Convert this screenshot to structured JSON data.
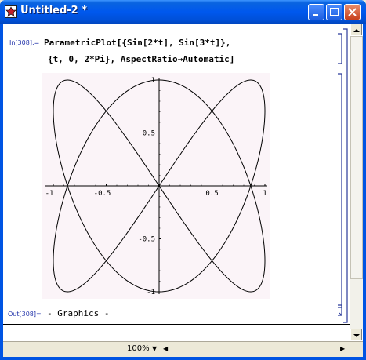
{
  "window": {
    "title": "Untitled-2 *",
    "icon": "mathematica-notebook-icon"
  },
  "cell_input": {
    "label": "In[308]:=",
    "line1": "ParametricPlot[{Sin[2*t], Sin[3*t]},",
    "line2": "{t, 0, 2*Pi}, AspectRatio→Automatic]"
  },
  "cell_output": {
    "label": "Out[308]=",
    "text": "- Graphics -"
  },
  "plot": {
    "x_ticks": [
      "-1",
      "-0.5",
      "0.5",
      "1"
    ],
    "y_ticks": [
      "1",
      "0.5",
      "-0.5",
      "-1"
    ],
    "background": "#fbf4f8"
  },
  "chart_data": {
    "type": "line",
    "title": "",
    "xlabel": "",
    "ylabel": "",
    "xlim": [
      -1,
      1
    ],
    "ylim": [
      -1,
      1
    ],
    "x_tick_values": [
      -1,
      -0.5,
      0.5,
      1
    ],
    "y_tick_values": [
      -1,
      -0.5,
      0.5,
      1
    ],
    "series": [
      {
        "x_expr": "sin(2t)",
        "y_expr": "sin(3t)",
        "t_range": [
          0,
          6.2832
        ]
      }
    ]
  },
  "statusbar": {
    "zoom": "100%"
  }
}
